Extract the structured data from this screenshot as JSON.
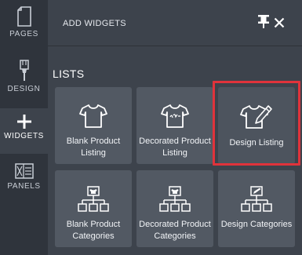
{
  "sidebar": {
    "items": [
      {
        "label": "PAGES",
        "icon": "page-icon"
      },
      {
        "label": "DESIGN",
        "icon": "brush-icon"
      },
      {
        "label": "WIDGETS",
        "icon": "plus-icon"
      },
      {
        "label": "PANELS",
        "icon": "panels-icon"
      }
    ]
  },
  "panel": {
    "title": "ADD WIDGETS",
    "pin_icon": "pin-icon",
    "close_icon": "close-icon",
    "section_title": "LISTS",
    "widgets": [
      {
        "label": "Blank Product Listing",
        "icon": "tshirt-icon"
      },
      {
        "label": "Decorated Product Listing",
        "icon": "tshirt-art-icon"
      },
      {
        "label": "Design Listing",
        "icon": "tshirt-pencil-icon",
        "selected": true
      },
      {
        "label": "Blank Product Categories",
        "icon": "category-tree-icon"
      },
      {
        "label": "Decorated Product Categories",
        "icon": "category-tree-art-icon"
      },
      {
        "label": "Design Categories",
        "icon": "category-tree-pencil-icon"
      }
    ]
  },
  "colors": {
    "highlight": "#e0333b",
    "sidebar_bg": "#2f343c",
    "panel_bg": "#3d434c",
    "card_bg": "#525963"
  }
}
